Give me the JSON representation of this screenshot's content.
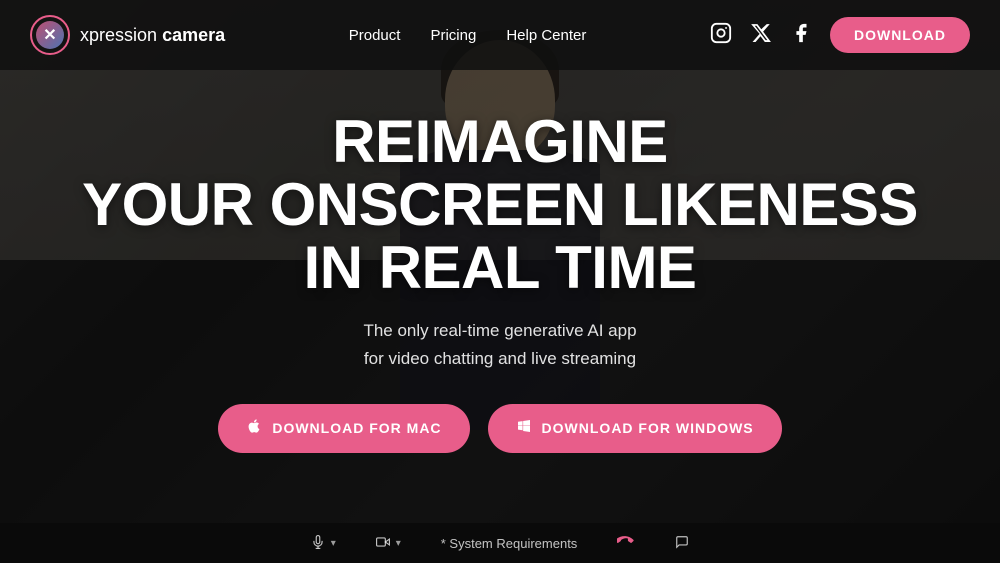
{
  "brand": {
    "logo_text_plain": "xpression",
    "logo_text_bold": "camera",
    "logo_icon_label": "xpression camera logo"
  },
  "navbar": {
    "links": [
      {
        "label": "Product",
        "id": "product"
      },
      {
        "label": "Pricing",
        "id": "pricing"
      },
      {
        "label": "Help Center",
        "id": "help-center"
      }
    ],
    "download_label": "DOWNLOAD",
    "socials": [
      {
        "name": "instagram",
        "symbol": "📷"
      },
      {
        "name": "twitter",
        "symbol": "𝕏"
      },
      {
        "name": "facebook",
        "symbol": "f"
      }
    ]
  },
  "hero": {
    "title_line1": "REIMAGINE",
    "title_line2": "YOUR ONSCREEN LIKENESS",
    "title_line3": "IN REAL TIME",
    "subtitle_line1": "The only real-time generative AI app",
    "subtitle_line2": "for video chatting and live streaming",
    "cta_mac_label": "DOWNLOAD FOR MAC",
    "cta_windows_label": "DOWNLOAD FOR WINDOWS",
    "mac_icon": "🍎",
    "windows_icon": "⊞"
  },
  "bottom_bar": {
    "items": [
      {
        "label": "",
        "icon": "🎤",
        "has_caret": true
      },
      {
        "label": "",
        "icon": "📹",
        "has_caret": true
      },
      {
        "label": "* System Requirements",
        "icon": ""
      },
      {
        "label": "",
        "icon": "📞",
        "style": "red"
      },
      {
        "label": "",
        "icon": "💬"
      }
    ]
  }
}
